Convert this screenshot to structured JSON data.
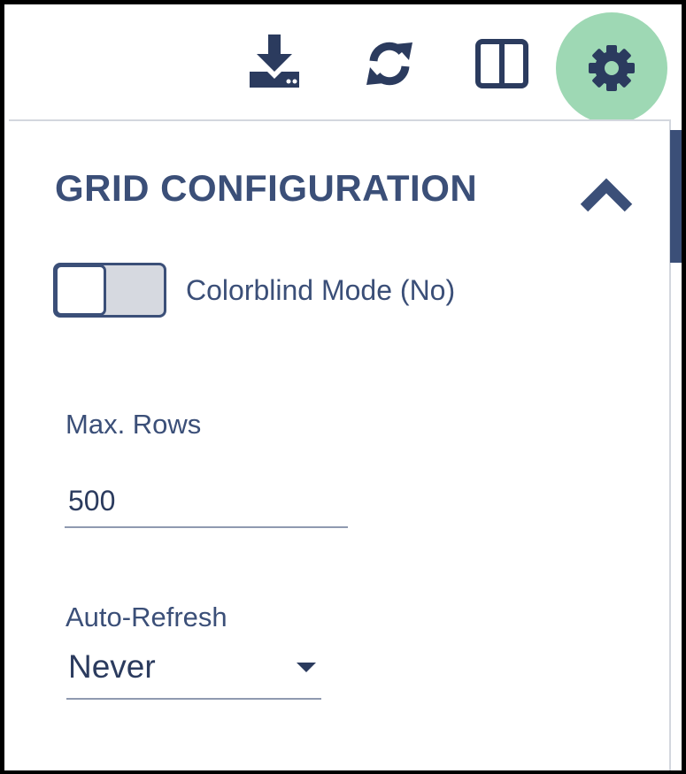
{
  "toolbar": {
    "icons": [
      "download-icon",
      "refresh-icon",
      "split-view-icon",
      "gear-icon"
    ],
    "active_color": "#9ed8b4",
    "icon_color": "#2b3b5e"
  },
  "panel": {
    "title": "GRID CONFIGURATION",
    "collapse_icon": "chevron-up-icon",
    "colorblind": {
      "label": "Colorblind Mode (No)",
      "on": false
    },
    "max_rows": {
      "label": "Max. Rows",
      "value": "500"
    },
    "auto_refresh": {
      "label": "Auto-Refresh",
      "selected": "Never"
    }
  },
  "colors": {
    "accent": "#3b4f78",
    "border": "#d3d7de"
  }
}
